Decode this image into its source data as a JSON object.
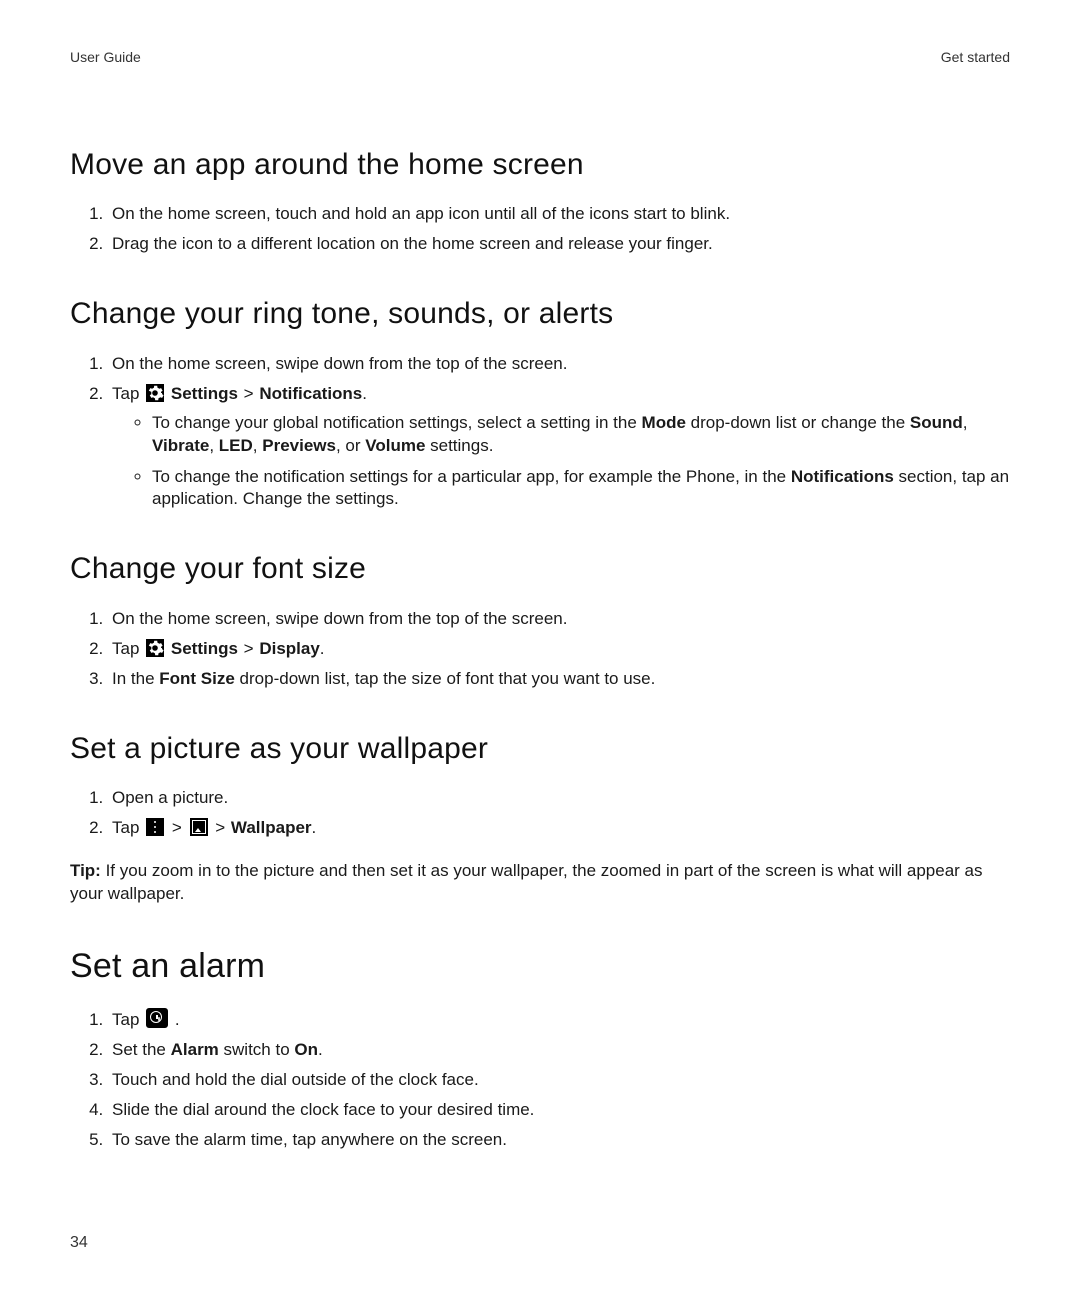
{
  "header": {
    "left": "User Guide",
    "right": "Get started"
  },
  "sections": {
    "move": {
      "title": "Move an app around the home screen",
      "step1": "On the home screen, touch and hold an app icon until all of the icons start to blink.",
      "step2": "Drag the icon to a different location on the home screen and release your finger."
    },
    "ringtone": {
      "title": "Change your ring tone, sounds, or alerts",
      "step1": "On the home screen, swipe down from the top of the screen.",
      "step2_pre": "Tap ",
      "step2_settings": "Settings",
      "step2_gt": " > ",
      "step2_notifications": "Notifications",
      "step2_period": ".",
      "bullet1_pre": "To change your global notification settings, select a setting in the ",
      "bullet1_mode": "Mode",
      "bullet1_mid": " drop-down list or change the ",
      "bullet1_sound": "Sound",
      "bullet1_c1": ", ",
      "bullet1_vibrate": "Vibrate",
      "bullet1_c2": ", ",
      "bullet1_led": "LED",
      "bullet1_c3": ", ",
      "bullet1_previews": "Previews",
      "bullet1_c4": ", or ",
      "bullet1_volume": "Volume",
      "bullet1_end": " settings.",
      "bullet2_pre": "To change the notification settings for a particular app, for example the Phone, in the ",
      "bullet2_notif": "Notifications",
      "bullet2_end": " section, tap an application. Change the settings."
    },
    "fontsize": {
      "title": "Change your font size",
      "step1": "On the home screen, swipe down from the top of the screen.",
      "step2_pre": "Tap ",
      "step2_settings": "Settings",
      "step2_gt": " > ",
      "step2_display": "Display",
      "step2_period": ".",
      "step3_pre": "In the ",
      "step3_fontsize": "Font Size",
      "step3_end": " drop-down list, tap the size of font that you want to use."
    },
    "wallpaper": {
      "title": "Set a picture as your wallpaper",
      "step1": "Open a picture.",
      "step2_pre": "Tap ",
      "step2_gt1": " > ",
      "step2_gt2": " > ",
      "step2_wallpaper": "Wallpaper",
      "step2_period": ".",
      "tip_label": "Tip:",
      "tip_text": " If you zoom in to the picture and then set it as your wallpaper, the zoomed in part of the screen is what will appear as your wallpaper."
    },
    "alarm": {
      "title": "Set an alarm",
      "step1_pre": "Tap ",
      "step1_period": " .",
      "step2_pre": "Set the ",
      "step2_alarm": "Alarm",
      "step2_mid": " switch to ",
      "step2_on": "On",
      "step2_period": ".",
      "step3": "Touch and hold the dial outside of the clock face.",
      "step4": "Slide the dial around the clock face to your desired time.",
      "step5": "To save the alarm time, tap anywhere on the screen."
    }
  },
  "pageNumber": "34"
}
